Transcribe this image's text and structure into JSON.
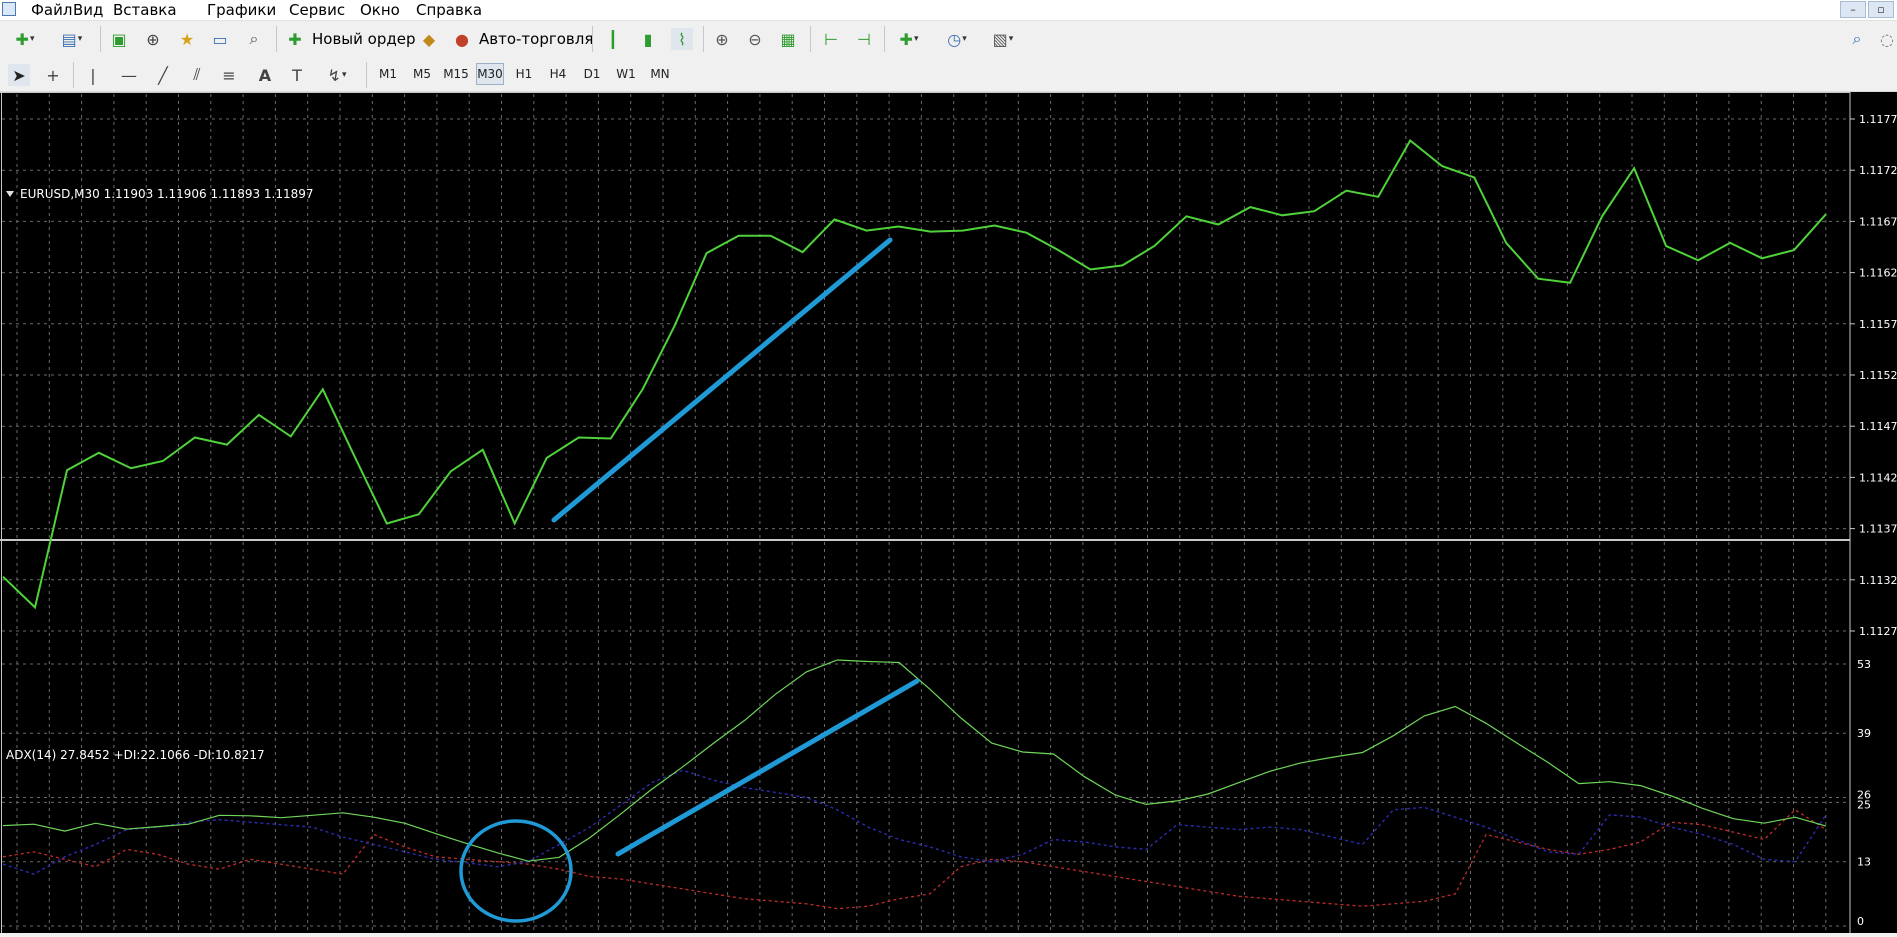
{
  "menu": {
    "items": [
      "Файл",
      "Вид",
      "Вставка",
      "Графики",
      "Сервис",
      "Окно",
      "Справка"
    ],
    "window_controls": [
      "–",
      "▫"
    ]
  },
  "toolbar": {
    "new_order_label": "Новый ордер",
    "auto_trading_label": "Авто-торговля"
  },
  "timeframes": [
    "M1",
    "M5",
    "M15",
    "M30",
    "H1",
    "H4",
    "D1",
    "W1",
    "MN"
  ],
  "active_timeframe": "M30",
  "chart": {
    "header": "EURUSD,M30  1.11903 1.11906 1.11893 1.11897",
    "price_axis_labels": [
      "1.11770",
      "1.11720",
      "1.11670",
      "1.11620",
      "1.11570",
      "1.11520",
      "1.11470",
      "1.11420",
      "1.11370",
      "1.11320",
      "1.11270"
    ],
    "line_color": "#4fd23a",
    "annotation_color": "#1f9ad6"
  },
  "indicator": {
    "header": "ADX(14) 27.8452 +DI:22.1066 -DI:10.8217",
    "axis_labels": [
      "53",
      "39",
      "26",
      "25",
      "13",
      "0"
    ],
    "adx_color": "#6fd65a",
    "plus_di_color": "#2b2bb0",
    "minus_di_color": "#c02a2a"
  },
  "chart_data": [
    {
      "type": "line",
      "y": [
        1.11323,
        1.11293,
        1.11427,
        1.11444,
        1.11429,
        1.11436,
        1.11459,
        1.11452,
        1.11481,
        1.1146,
        1.11506,
        1.1144,
        1.11375,
        1.11384,
        1.11426,
        1.11447,
        1.11375,
        1.11439,
        1.11459,
        1.11458,
        1.11506,
        1.11568,
        1.11639,
        1.11656,
        1.11656,
        1.1164,
        1.11672,
        1.11661,
        1.11665,
        1.1166,
        1.11661,
        1.11666,
        1.11659,
        1.11642,
        1.11623,
        1.11627,
        1.11646,
        1.11675,
        1.11667,
        1.11684,
        1.11676,
        1.1168,
        1.117,
        1.11694,
        1.11749,
        1.11724,
        1.11713,
        1.11649,
        1.11614,
        1.1161,
        1.11675,
        1.11722,
        1.11646,
        1.11632,
        1.11649,
        1.11634,
        1.11642,
        1.11677
      ],
      "ylim": [
        1.1127,
        1.1177
      ]
    },
    {
      "type": "line",
      "series": [
        {
          "name": "ADX(14)",
          "values": [
            20.3,
            20.6,
            19.2,
            20.8,
            19.6,
            20.1,
            20.6,
            22.4,
            22.3,
            21.9,
            22.4,
            22.9,
            22.0,
            20.8,
            18.7,
            16.7,
            14.8,
            13.1,
            13.9,
            17.9,
            22.7,
            27.7,
            32.2,
            37.0,
            41.6,
            46.9,
            51.4,
            53.8,
            53.5,
            53.3,
            47.9,
            42.1,
            37.0,
            35.2,
            34.8,
            30.2,
            26.5,
            24.6,
            25.3,
            26.7,
            29.0,
            31.3,
            33.0,
            34.1,
            35.1,
            38.5,
            42.5,
            44.4,
            41.0,
            37.0,
            33.1,
            28.8,
            29.2,
            28.4,
            26.3,
            23.8,
            21.7,
            20.8,
            22.0,
            20.2
          ]
        },
        {
          "name": "+DI",
          "values": [
            12.5,
            10.5,
            14.0,
            16.5,
            19.5,
            20.0,
            21.0,
            21.5,
            21.0,
            20.5,
            20.0,
            18.0,
            16.5,
            15.0,
            13.5,
            12.8,
            12.0,
            13.0,
            16.5,
            20.0,
            24.5,
            29.0,
            31.5,
            29.5,
            28.0,
            27.0,
            26.0,
            23.5,
            20.0,
            17.5,
            16.0,
            14.0,
            13.0,
            14.5,
            17.5,
            17.0,
            16.0,
            15.5,
            20.5,
            20.0,
            19.5,
            20.0,
            19.5,
            18.0,
            16.5,
            23.5,
            24.0,
            22.0,
            20.0,
            17.5,
            15.0,
            14.5,
            22.5,
            22.0,
            20.0,
            18.5,
            16.5,
            13.5,
            13.0,
            22.5
          ]
        },
        {
          "name": "-DI",
          "values": [
            14.0,
            15.0,
            13.5,
            12.0,
            15.5,
            14.5,
            12.5,
            11.5,
            13.5,
            12.5,
            11.5,
            10.5,
            18.5,
            16.0,
            14.0,
            13.5,
            13.0,
            12.5,
            11.5,
            10.0,
            9.5,
            8.5,
            7.5,
            6.5,
            5.5,
            5.0,
            4.5,
            3.5,
            4.0,
            5.5,
            6.5,
            12.0,
            13.5,
            13.0,
            12.0,
            11.0,
            10.0,
            9.0,
            8.0,
            7.0,
            6.0,
            5.5,
            5.0,
            4.5,
            4.0,
            4.5,
            5.0,
            6.5,
            18.5,
            17.0,
            15.5,
            14.5,
            15.5,
            17.0,
            21.0,
            20.5,
            19.0,
            17.5,
            23.5,
            19.5
          ]
        }
      ],
      "ylim": [
        0,
        53
      ]
    }
  ]
}
